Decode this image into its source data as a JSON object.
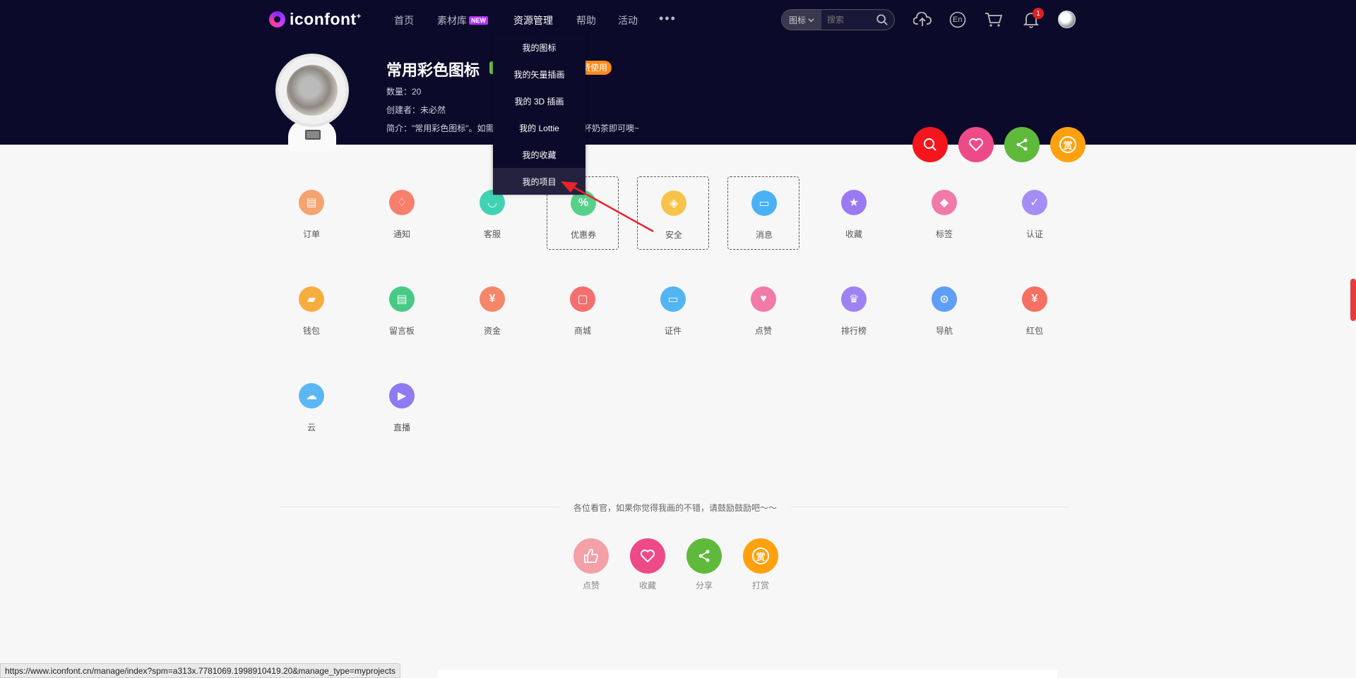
{
  "header": {
    "logo_text": "iconfont",
    "logo_sup": "+",
    "nav": {
      "home": "首页",
      "materials": "素材库",
      "materials_badge": "NEW",
      "resources": "资源管理",
      "help": "帮助",
      "activity": "活动",
      "more": "•••"
    },
    "search": {
      "type": "图标",
      "placeholder": "搜索"
    },
    "notification_count": "1",
    "lang_label": "En"
  },
  "dropdown": {
    "items": [
      "我的图标",
      "我的矢量插画",
      "我的 3D 插画",
      "我的 Lottie",
      "我的收藏",
      "我的项目"
    ],
    "highlighted_index": 5
  },
  "profile": {
    "title": "常用彩色图标",
    "tag_orange": "免费使用",
    "tag_orange_visible": "费使用",
    "count": "数量：20",
    "creator": "创建者：未必然",
    "desc_prefix": "简介：\"常用彩色图标\"。如需",
    "desc_suffix": "杯奶茶即可噢~"
  },
  "action_buttons": {
    "search": "search-icon",
    "favorite": "heart-icon",
    "share": "share-icon",
    "reward": "赏"
  },
  "icons": [
    {
      "label": "订单",
      "color": "#f5a370"
    },
    {
      "label": "通知",
      "color": "#f87f6b"
    },
    {
      "label": "客服",
      "color": "#3fd3b4"
    },
    {
      "label": "优惠券",
      "color": "#59d08a"
    },
    {
      "label": "安全",
      "color": "#f7c34a"
    },
    {
      "label": "消息",
      "color": "#4ab1f5"
    },
    {
      "label": "收藏",
      "color": "#9b79f2"
    },
    {
      "label": "标签",
      "color": "#f07ba8"
    },
    {
      "label": "认证",
      "color": "#a48ef5"
    },
    {
      "label": "钱包",
      "color": "#f7ad3e"
    },
    {
      "label": "留言板",
      "color": "#48ca85"
    },
    {
      "label": "资金",
      "color": "#f5866a"
    },
    {
      "label": "商城",
      "color": "#f56f6f"
    },
    {
      "label": "证件",
      "color": "#52b5f2"
    },
    {
      "label": "点赞",
      "color": "#f27aa6"
    },
    {
      "label": "排行榜",
      "color": "#9e82f0"
    },
    {
      "label": "导航",
      "color": "#5e9ef5"
    },
    {
      "label": "红包",
      "color": "#f57062"
    },
    {
      "label": "云",
      "color": "#5cb6f5"
    },
    {
      "label": "直播",
      "color": "#8f7af2"
    }
  ],
  "footer": {
    "message": "各位看官，如果你觉得我画的不错，请鼓励鼓励吧～～",
    "buttons": {
      "like": "点赞",
      "favorite": "收藏",
      "share": "分享",
      "reward": "打赏"
    },
    "reward_glyph": "赏"
  },
  "status_url": "https://www.iconfont.cn/manage/index?spm=a313x.7781069.1998910419.20&manage_type=myprojects",
  "colors": {
    "header_bg": "#0c0a2a",
    "red": "#f5161d",
    "pink": "#ee4a88",
    "green": "#5fba3c",
    "orange": "#ffa10f",
    "light_pink": "#f3a0a8"
  }
}
